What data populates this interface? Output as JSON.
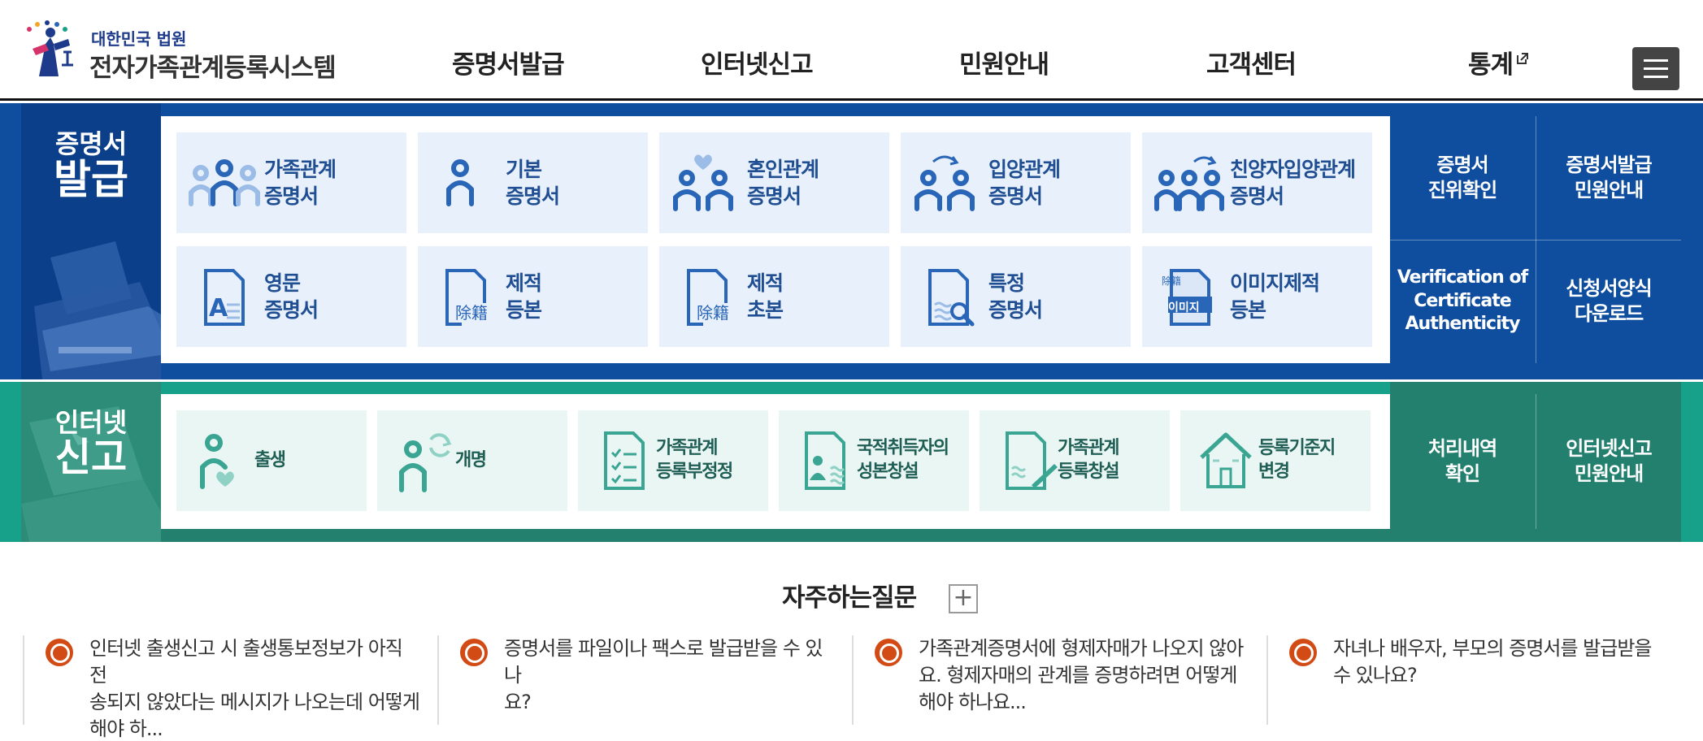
{
  "header": {
    "logo_sub": "대한민국 법원",
    "logo_main": "전자가족관계등록시스템",
    "nav": [
      {
        "label": "증명서발급"
      },
      {
        "label": "인터넷신고"
      },
      {
        "label": "민원안내"
      },
      {
        "label": "고객센터"
      },
      {
        "label": "통계"
      }
    ]
  },
  "cert": {
    "side_line1": "증명서",
    "side_line2": "발급",
    "tiles": [
      {
        "line1": "가족관계",
        "line2": "증명서",
        "icon": "family-icon"
      },
      {
        "line1": "기본",
        "line2": "증명서",
        "icon": "person-icon"
      },
      {
        "line1": "혼인관계",
        "line2": "증명서",
        "icon": "marriage-icon"
      },
      {
        "line1": "입양관계",
        "line2": "증명서",
        "icon": "adoption-icon"
      },
      {
        "line1": "친양자입양관계",
        "line2": "증명서",
        "icon": "full-adoption-icon"
      },
      {
        "line1": "영문",
        "line2": "증명서",
        "icon": "english-document-icon"
      },
      {
        "line1": "제적",
        "line2": "등본",
        "icon": "removed-register-copy-icon",
        "stamp": "除籍"
      },
      {
        "line1": "제적",
        "line2": "초본",
        "icon": "removed-register-abstract-icon",
        "stamp": "除籍"
      },
      {
        "line1": "특정",
        "line2": "증명서",
        "icon": "specific-document-search-icon"
      },
      {
        "line1": "이미지제적",
        "line2": "등본",
        "icon": "image-register-icon",
        "stamp": "除籍",
        "tag": "이미지"
      }
    ],
    "links": [
      {
        "line1": "증명서",
        "line2": "진위확인"
      },
      {
        "line1": "증명서발급",
        "line2": "민원안내"
      },
      {
        "line1": "Verification of",
        "line2": "Certificate",
        "line3": "Authenticity"
      },
      {
        "line1": "신청서양식",
        "line2": "다운로드"
      }
    ]
  },
  "report": {
    "side_line1": "인터넷",
    "side_line2": "신고",
    "tiles": [
      {
        "line1": "출생",
        "line2": "",
        "icon": "birth-icon"
      },
      {
        "line1": "개명",
        "line2": "",
        "icon": "rename-icon"
      },
      {
        "line1": "가족관계",
        "line2": "등록부정정",
        "icon": "register-correction-icon"
      },
      {
        "line1": "국적취득자의",
        "line2": "성본창설",
        "icon": "nationality-surname-icon"
      },
      {
        "line1": "가족관계",
        "line2": "등록창설",
        "icon": "register-creation-icon"
      },
      {
        "line1": "등록기준지",
        "line2": "변경",
        "icon": "home-change-icon"
      }
    ],
    "links": [
      {
        "line1": "처리내역",
        "line2": "확인"
      },
      {
        "line1": "인터넷신고",
        "line2": "민원안내"
      }
    ]
  },
  "faq": {
    "title": "자주하는질문",
    "plus": "+",
    "items": [
      {
        "line1": "인터넷 출생신고 시 출생통보정보가 아직 전",
        "line2": "송되지 않았다는 메시지가 나오는데 어떻게",
        "line3": "해야 하..."
      },
      {
        "line1": "증명서를 파일이나 팩스로 발급받을 수 있나",
        "line2": "요?",
        "line3": ""
      },
      {
        "line1": "가족관계증명서에 형제자매가 나오지 않아",
        "line2": "요. 형제자매의 관계를 증명하려면 어떻게",
        "line3": "해야 하나요..."
      },
      {
        "line1": "자녀나 배우자, 부모의 증명서를 발급받을 ",
        "line2": "수 있나요?",
        "line3": ""
      }
    ]
  },
  "colors": {
    "cert_blue": "#0f4d9e",
    "tile_blue": "#e8f0fb",
    "text_blue": "#1f4e92",
    "icon_blue": "#2a66b8",
    "report_green": "#17a08a",
    "tile_green": "#eaf6f3",
    "text_green": "#1f5e55",
    "faq_orange": "#d24b14"
  }
}
